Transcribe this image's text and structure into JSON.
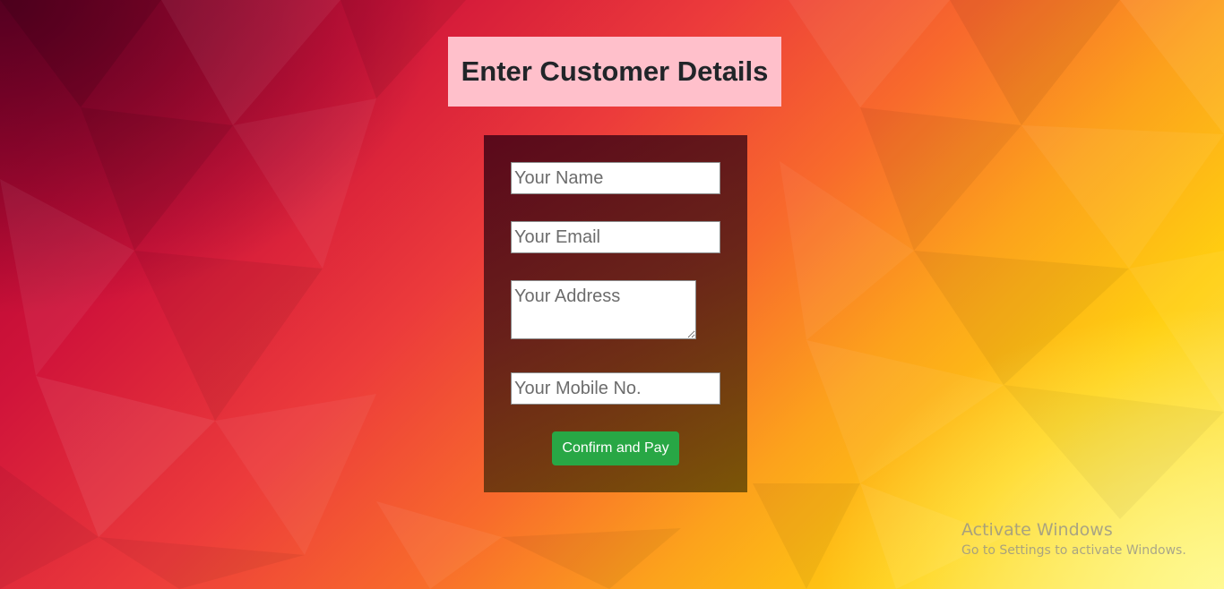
{
  "page": {
    "heading": "Enter Customer Details"
  },
  "form": {
    "name_placeholder": "Your Name",
    "email_placeholder": "Your Email",
    "address_placeholder": "Your Address",
    "mobile_placeholder": "Your Mobile No.",
    "submit_label": "Confirm and Pay"
  },
  "watermark": {
    "title": "Activate Windows",
    "subtitle": "Go to Settings to activate Windows."
  },
  "colors": {
    "heading_bg": "#ffc0cb",
    "submit_bg": "#28a745",
    "form_bg": "rgba(60,10,20,0.8)"
  }
}
